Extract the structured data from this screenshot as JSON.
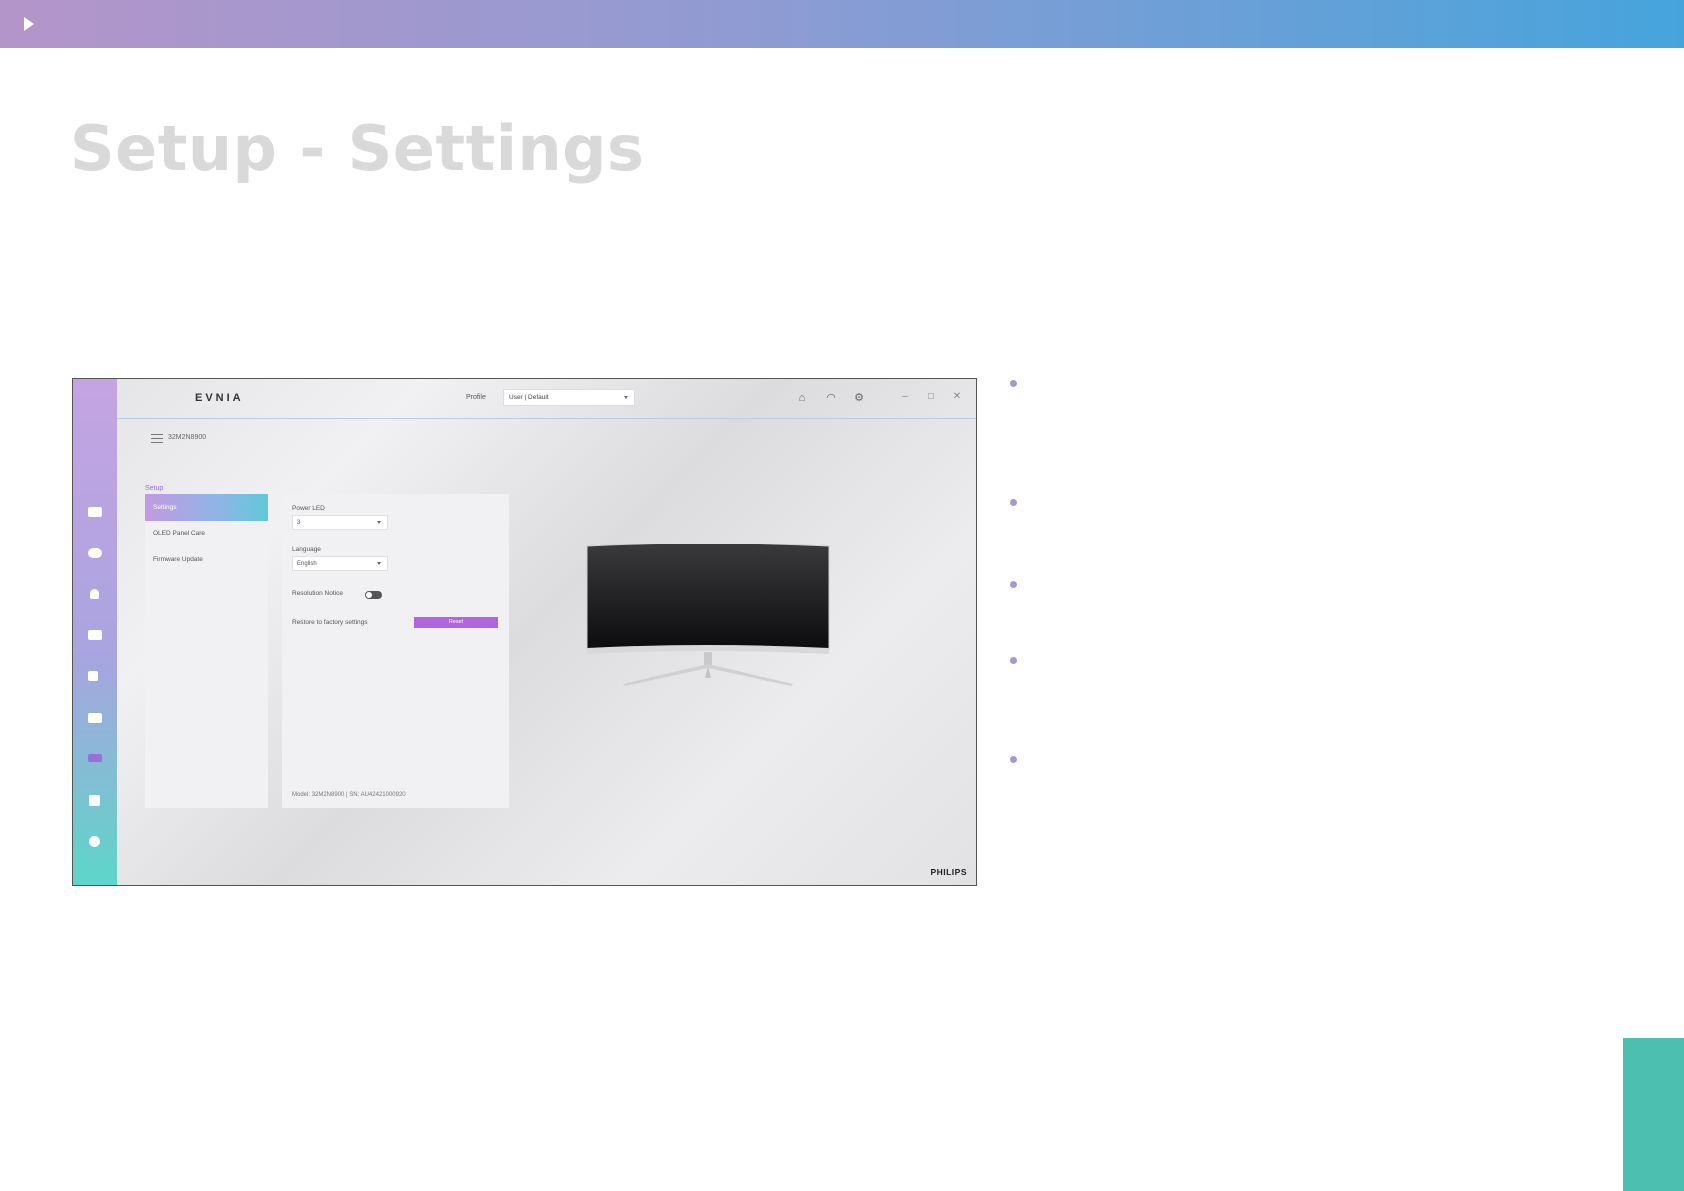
{
  "slide": {
    "title": "Setup - Settings"
  },
  "app": {
    "brand": "EVNIA",
    "profile": {
      "label": "Profile",
      "value": "User | Default"
    },
    "device_name": "32M2N8900",
    "section_label": "Setup",
    "submenu": [
      {
        "label": "Settings",
        "active": true
      },
      {
        "label": "OLED Panel Care",
        "active": false
      },
      {
        "label": "Firmware Update",
        "active": false
      }
    ],
    "settings": {
      "power_led_label": "Power LED",
      "power_led_value": "3",
      "language_label": "Language",
      "language_value": "English",
      "resolution_notice_label": "Resolution Notice",
      "restore_label": "Restore to factory settings",
      "reset_button": "Reset",
      "model_line": "Model: 32M2N8900 | SN: AU42421000920"
    },
    "footer_logo": "PHILIPS",
    "colors": {
      "accent": "#b166df",
      "rail_top": "#c5a4e2",
      "rail_bottom": "#5dd6c8"
    },
    "icons": {
      "rail": [
        "display-icon",
        "gamepad-icon",
        "bulb-icon",
        "picture-icon",
        "speaker-icon",
        "monitor-settings-icon",
        "sliders-icon",
        "grid-icon",
        "refresh-icon"
      ],
      "titlebar": [
        "home-icon",
        "gauge-icon",
        "gear-icon"
      ],
      "window": [
        "minimize-icon",
        "maximize-icon",
        "close-icon"
      ]
    }
  }
}
